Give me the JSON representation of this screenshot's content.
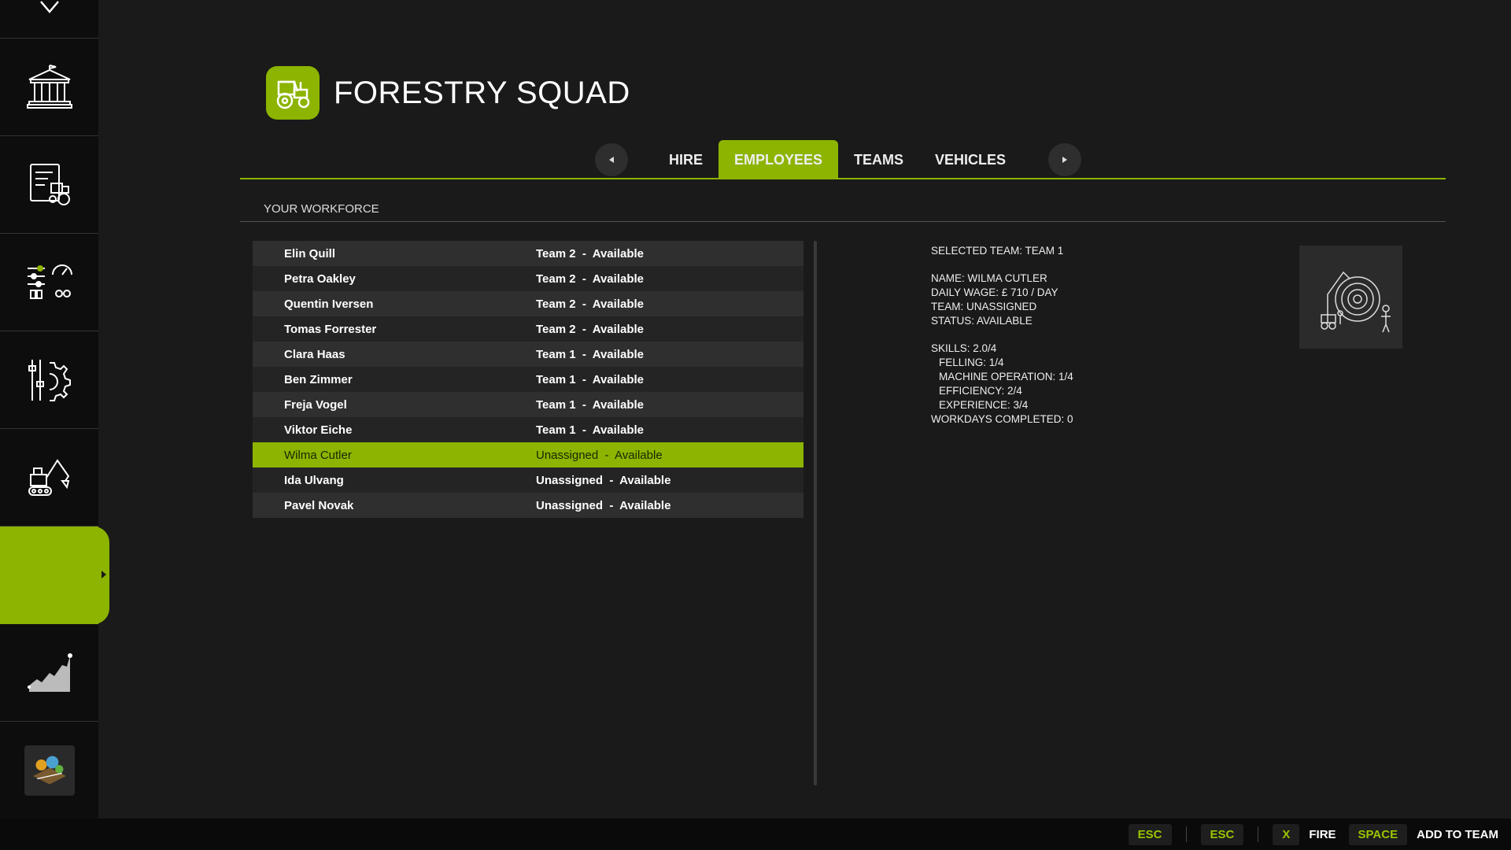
{
  "header": {
    "title": "FORESTRY SQUAD",
    "logo_icon": "tractor-icon"
  },
  "tabs": [
    {
      "label": "HIRE",
      "active": false
    },
    {
      "label": "EMPLOYEES",
      "active": true
    },
    {
      "label": "TEAMS",
      "active": false
    },
    {
      "label": "VEHICLES",
      "active": false
    }
  ],
  "section": {
    "title": "YOUR WORKFORCE"
  },
  "employees": [
    {
      "name": "Elin Quill",
      "status": "Team 2  -  Available"
    },
    {
      "name": "Petra Oakley",
      "status": "Team 2  -  Available"
    },
    {
      "name": "Quentin Iversen",
      "status": "Team 2  -  Available"
    },
    {
      "name": "Tomas Forrester",
      "status": "Team 2  -  Available"
    },
    {
      "name": "Clara Haas",
      "status": "Team 1  -  Available"
    },
    {
      "name": "Ben Zimmer",
      "status": "Team 1  -  Available"
    },
    {
      "name": "Freja Vogel",
      "status": "Team 1  -  Available"
    },
    {
      "name": "Viktor Eiche",
      "status": "Team 1  -  Available"
    },
    {
      "name": "Wilma Cutler",
      "status": "Unassigned  -  Available"
    },
    {
      "name": "Ida Ulvang",
      "status": "Unassigned  -  Available"
    },
    {
      "name": "Pavel Novak",
      "status": "Unassigned  -  Available"
    }
  ],
  "selected_index": 8,
  "details": {
    "selected_team": "SELECTED TEAM: TEAM 1",
    "name": "NAME: WILMA CUTLER",
    "wage": "DAILY WAGE: £ 710 / DAY",
    "team": "TEAM: UNASSIGNED",
    "status": "STATUS: AVAILABLE",
    "skills": "SKILLS: 2.0/4",
    "felling": "FELLING: 1/4",
    "machine": "MACHINE OPERATION: 1/4",
    "efficiency": "EFFICIENCY: 2/4",
    "experience": "EXPERIENCE: 3/4",
    "workdays": "WORKDAYS COMPLETED: 0"
  },
  "footer": {
    "key1": "ESC",
    "key2": "ESC",
    "key3": "X",
    "action3": "FIRE",
    "key4": "SPACE",
    "action4": "ADD TO TEAM"
  },
  "colors": {
    "accent": "#8cb400",
    "sidebar_bg": "#0d0d0d",
    "main_bg": "#1a1a1a"
  },
  "sidebar_icons": [
    "chevron-down-icon",
    "bank-icon",
    "tractor-contract-icon",
    "settings-gauge-icon",
    "gear-sliders-icon",
    "excavator-icon",
    "active-menu-item",
    "growth-chart-icon",
    "map-icon"
  ]
}
